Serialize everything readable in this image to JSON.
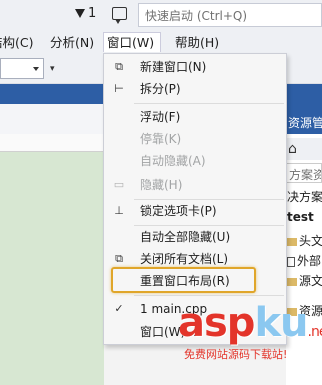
{
  "titlebar": {
    "flag_count": "1",
    "quick_launch_placeholder": "快速启动 (Ctrl+Q)"
  },
  "menubar": {
    "items": [
      {
        "label": "结构(C)"
      },
      {
        "label": "分析(N)"
      },
      {
        "label": "窗口(W)"
      },
      {
        "label": "帮助(H)"
      }
    ]
  },
  "toolbar": {
    "overflow_glyph": "▾"
  },
  "window_menu": {
    "items": [
      {
        "label": "新建窗口(N)",
        "icon": "new-window-icon",
        "enabled": true
      },
      {
        "label": "拆分(P)",
        "icon": "split-icon",
        "enabled": true
      },
      {
        "label": "浮动(F)",
        "enabled": true
      },
      {
        "label": "停靠(K)",
        "enabled": false
      },
      {
        "label": "自动隐藏(A)",
        "enabled": false
      },
      {
        "label": "隐藏(H)",
        "icon": "hide-icon",
        "enabled": false
      },
      {
        "label": "锁定选项卡(P)",
        "icon": "pin-icon",
        "enabled": true
      },
      {
        "label": "自动全部隐藏(U)",
        "enabled": true
      },
      {
        "label": "关闭所有文档(L)",
        "icon": "close-all-icon",
        "enabled": true
      },
      {
        "label": "重置窗口布局(R)",
        "enabled": true,
        "highlighted": true
      },
      {
        "label": "1 main.cpp",
        "icon": "checkmark-icon",
        "enabled": true
      },
      {
        "label": "窗口(W)...",
        "enabled": true
      }
    ],
    "highlight_color": "#e0a62a"
  },
  "solution_explorer": {
    "title": "资源管",
    "search_placeholder": "方案资",
    "tree": [
      {
        "label": "决方案"
      },
      {
        "label": "test"
      },
      {
        "label": "头文"
      },
      {
        "label": "外部"
      },
      {
        "label": "源文"
      },
      {
        "label": "资源"
      }
    ]
  },
  "watermark": {
    "brand_asp": "asp",
    "brand_ku": "ku",
    "brand_net": ".net",
    "tagline": "免费网站源码下载站!"
  },
  "colors": {
    "accent_blue": "#2d5ea5",
    "editor_bg": "#d7e7d2",
    "menu_bg": "#f6f6f6",
    "watermark_red": "#e3342a"
  }
}
